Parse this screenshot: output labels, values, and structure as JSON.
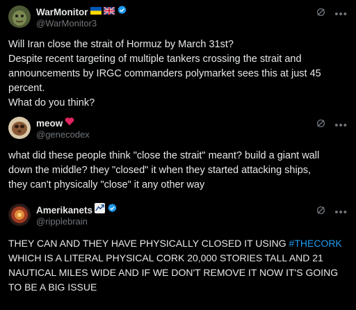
{
  "posts": [
    {
      "author": {
        "name": "WarMonitor",
        "handle": "@WarMonitor3",
        "flags": [
          "ua-flag",
          "uk-flag"
        ],
        "verified": true
      },
      "body_lines": [
        "Will Iran close the strait of Hormuz by March 31st?",
        "Despite recent targeting of multiple tankers crossing the strait and",
        "announcements by IRGC commanders polymarket sees this at just 45",
        "percent.",
        "What do you think?"
      ]
    },
    {
      "author": {
        "name": "meow",
        "handle": "@genecodex",
        "emoji": "red-heart",
        "verified": false
      },
      "body_lines": [
        "what did these people think \"close the strait\" meant? build a giant wall",
        "down the middle? they \"closed\" it when they started attacking ships,",
        "they can't physically \"close\" it any other way"
      ]
    },
    {
      "author": {
        "name": "Amerikanets",
        "handle": "@ripplebrain",
        "emoji": "chart-icon",
        "verified": true
      },
      "body_lines_prefix": "THEY CAN AND THEY HAVE PHYSICALLY CLOSED IT USING ",
      "hashtag": "#THECORK",
      "body_lines": [
        "WHICH IS A LITERAL PHYSICAL CORK 20,000 STORIES TALL AND 21",
        "NAUTICAL MILES WIDE AND IF WE DON'T REMOVE IT NOW IT'S GOING",
        "TO BE A BIG ISSUE"
      ]
    }
  ],
  "colors": {
    "background": "#000000",
    "text": "#e7e9ea",
    "muted": "#71767b",
    "link": "#1d9bf0",
    "verified": "#1d9bf0"
  },
  "icons": [
    "grok-icon",
    "more-icon"
  ]
}
